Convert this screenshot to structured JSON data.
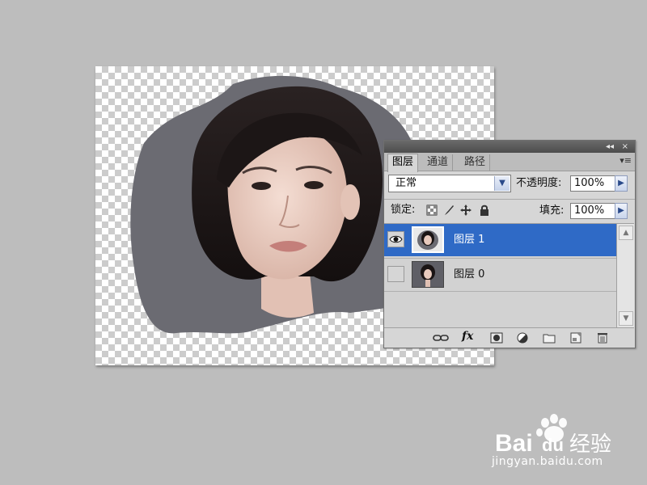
{
  "panel": {
    "tabs": [
      {
        "label": "图层",
        "active": true
      },
      {
        "label": "通道",
        "active": false
      },
      {
        "label": "路径",
        "active": false
      }
    ],
    "titlebar": {
      "collapse_glyph": "◂◂",
      "close_glyph": "×"
    },
    "menu_glyph": "▾≡",
    "blend_mode": "正常",
    "opacity_label": "不透明度:",
    "opacity_value": "100%",
    "lock_label": "锁定:",
    "fill_label": "填充:",
    "fill_value": "100%",
    "layers": [
      {
        "name": "图层 1",
        "visible": true,
        "selected": true
      },
      {
        "name": "图层 0",
        "visible": false,
        "selected": false
      }
    ],
    "footer_icons": [
      "link-icon",
      "fx-icon",
      "mask-icon",
      "adjustment-icon",
      "folder-icon",
      "new-layer-icon",
      "trash-icon"
    ],
    "fx_label": "fx"
  },
  "colors": {
    "selection": "#2f6ac6",
    "canvas_grey": "#6b6b72",
    "app_background": "#bdbdbd"
  },
  "watermark": {
    "brand_latin": "Bai",
    "brand_latin_2": "du",
    "brand_cn": "经验",
    "url": "jingyan.baidu.com"
  }
}
